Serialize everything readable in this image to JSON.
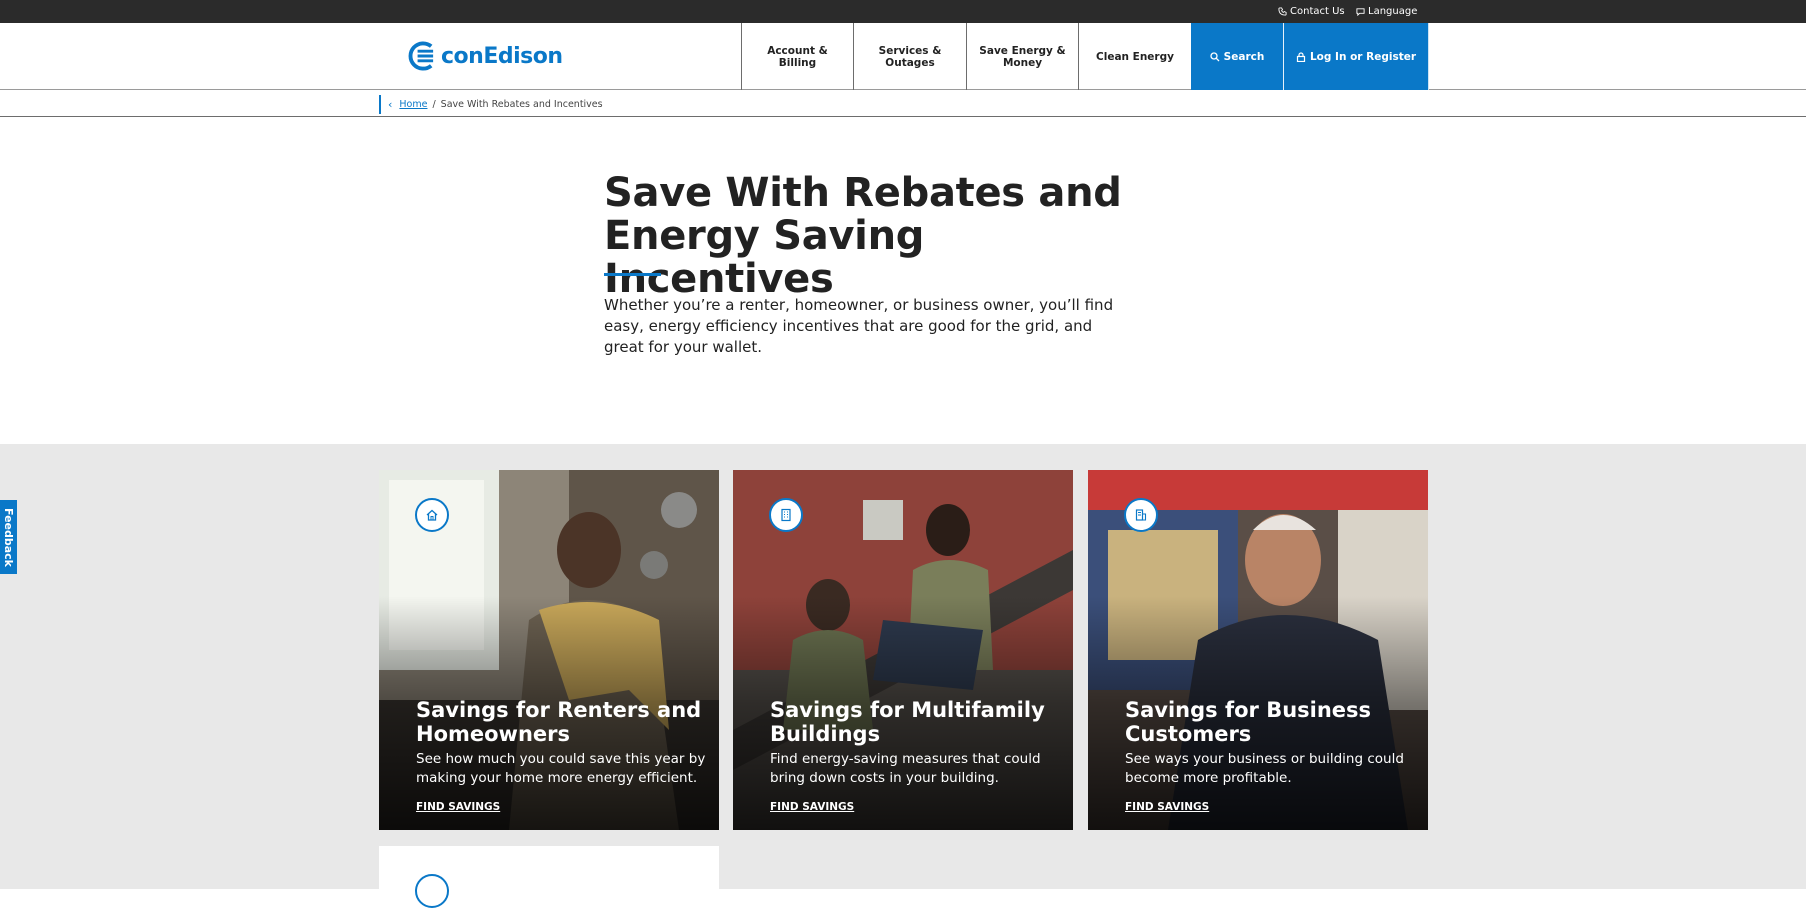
{
  "utility": {
    "contact_label": "Contact Us",
    "language_label": "Language"
  },
  "brand": {
    "name": "conEdison",
    "color": "#0a78c8"
  },
  "nav": {
    "items": [
      {
        "label": "Account &\nBilling"
      },
      {
        "label": "Services &\nOutages"
      },
      {
        "label": "Save Energy &\nMoney"
      },
      {
        "label": "Clean Energy"
      }
    ],
    "search_label": "Search",
    "login_label": "Log In or Register"
  },
  "breadcrumb": {
    "home_label": "Home",
    "separator": "/",
    "current": "Save With Rebates and Incentives"
  },
  "hero": {
    "title": "Save With Rebates and Energy Saving Incentives",
    "description": "Whether you’re a renter, homeowner, or business owner, you’ll find easy, energy efficiency incentives that are good for the grid, and great for your wallet."
  },
  "cards": [
    {
      "icon": "house-icon",
      "title": "Savings for Renters and Homeowners",
      "text": "See how much you could save this year by making your home more energy efficient.",
      "link": "FIND SAVINGS"
    },
    {
      "icon": "building-icon",
      "title": "Savings for Multifamily Buildings",
      "text": "Find energy-saving measures that could bring down costs in your building.",
      "link": "FIND SAVINGS"
    },
    {
      "icon": "storefront-icon",
      "title": "Savings for Business Customers",
      "text": "See ways your business or building could become more profitable.",
      "link": "FIND SAVINGS"
    }
  ],
  "feedback_label": "Feedback"
}
